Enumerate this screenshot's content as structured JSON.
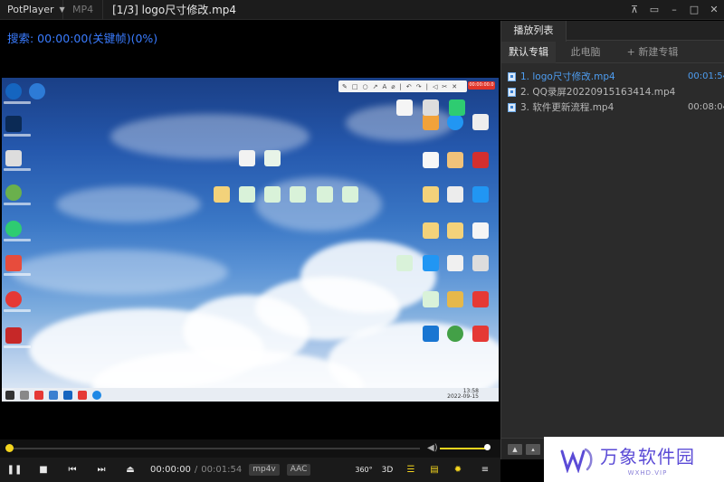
{
  "titlebar": {
    "app_name": "PotPlayer",
    "format": "MP4",
    "title": "[1/3] logo尺寸修改.mp4",
    "buttons": [
      "pin-icon",
      "restore-icon",
      "minimize-icon",
      "maximize-icon",
      "close-icon"
    ]
  },
  "osd": {
    "text": "搜索: 00:00:00(关键帧)(0%)"
  },
  "playlist": {
    "header_tab": "播放列表",
    "tabs": [
      {
        "label": "默认专辑",
        "active": true
      },
      {
        "label": "此电脑",
        "active": false
      },
      {
        "label": "+ 新建专辑",
        "active": false
      }
    ],
    "items": [
      {
        "name": "1. logo尺寸修改.mp4",
        "duration": "00:01:54",
        "active": true
      },
      {
        "name": "2. QQ录屏20220915163414.mp4",
        "duration": "",
        "active": false
      },
      {
        "name": "3. 软件更新流程.mp4",
        "duration": "00:08:04",
        "active": false
      }
    ]
  },
  "controls": {
    "current_time": "00:00:00",
    "separator": "/",
    "total_time": "00:01:54",
    "codec_badge": "mp4v",
    "audio_badge": "AAC",
    "progress": 0,
    "volume": 1.0,
    "vr_label": "360°",
    "3d_label": "3D"
  },
  "desktop_clock": {
    "time": "13:58",
    "date": "2022-09-15"
  },
  "desktop_rec": "00:00:00.0",
  "watermark": {
    "title": "万象软件园",
    "sub": "WXHD.VIP"
  },
  "colors": {
    "accent": "#f4d51e",
    "osd": "#3a7cff",
    "playlist_active": "#4e9ef2"
  }
}
